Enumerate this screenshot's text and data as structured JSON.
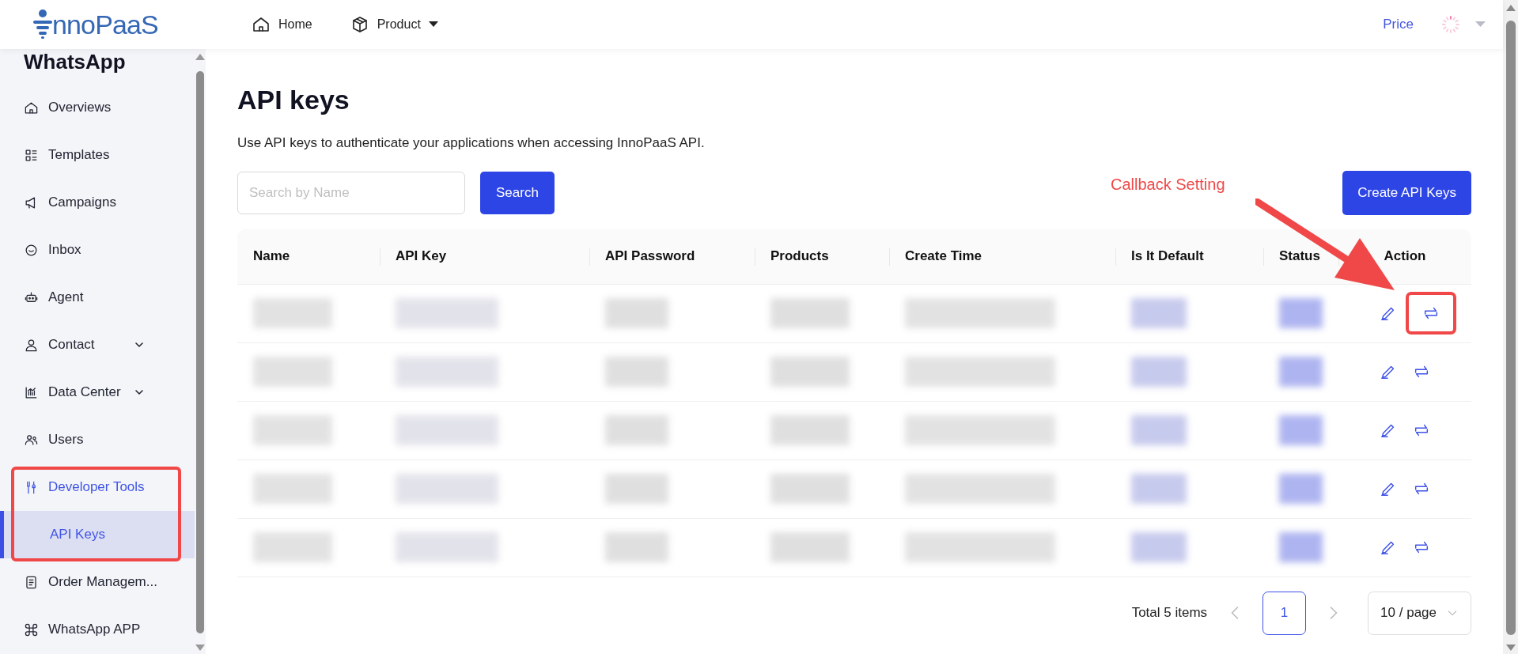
{
  "header": {
    "logo": "nnoPaaS",
    "nav": [
      {
        "label": "Home",
        "kind": "home"
      },
      {
        "label": "Product",
        "kind": "dropdown"
      }
    ],
    "price_link": "Price"
  },
  "sidebar": {
    "title": "WhatsApp",
    "items": [
      {
        "label": "Overviews"
      },
      {
        "label": "Templates"
      },
      {
        "label": "Campaigns"
      },
      {
        "label": "Inbox"
      },
      {
        "label": "Agent"
      },
      {
        "label": "Contact",
        "expanded": false,
        "highlighted": false
      },
      {
        "label": "Data Center",
        "expanded": false,
        "highlighted": false
      },
      {
        "label": "Users"
      },
      {
        "label": "Developer Tools",
        "expanded": true,
        "highlighted": true,
        "children": [
          {
            "label": "API Keys",
            "selected": true
          }
        ]
      },
      {
        "label": "Order Managem..."
      },
      {
        "label": "WhatsApp APP"
      }
    ]
  },
  "page": {
    "title": "API keys",
    "description": "Use API keys to authenticate your applications when accessing InnoPaaS API.",
    "search": {
      "placeholder": "Search by Name"
    },
    "search_button": "Search",
    "create_button": "Create API Keys"
  },
  "annotation": {
    "label": "Callback Setting"
  },
  "table": {
    "columns": [
      "Name",
      "API Key",
      "API Password",
      "Products",
      "Create Time",
      "Is It Default",
      "Status",
      "Action"
    ],
    "rows": [
      {
        "redacted": true,
        "callback_highlighted": true
      },
      {
        "redacted": true,
        "callback_highlighted": false
      },
      {
        "redacted": true,
        "callback_highlighted": false
      },
      {
        "redacted": true,
        "callback_highlighted": false
      },
      {
        "redacted": true,
        "callback_highlighted": false
      }
    ]
  },
  "pagination": {
    "total": "Total 5 items",
    "pages": [
      {
        "label": "1",
        "selected": true
      }
    ],
    "page_size": "10 / page"
  }
}
